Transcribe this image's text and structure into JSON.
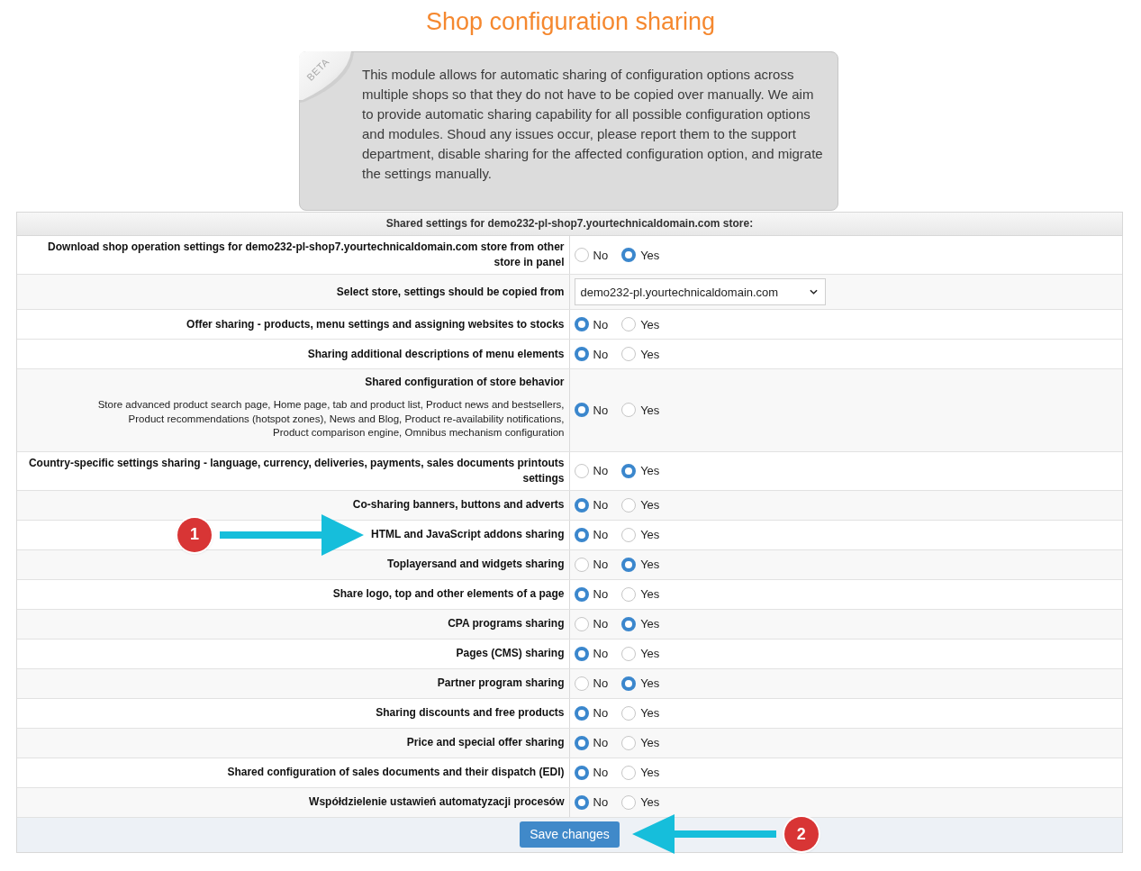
{
  "title": "Shop configuration sharing",
  "notice": {
    "ribbon": "BETA",
    "text": "This module allows for automatic sharing of configuration options across multiple shops so that they do not have to be copied over manually. We aim to provide automatic sharing capability for all possible configuration options and modules. Shoud any issues occur, please report them to the support department, disable sharing for the affected configuration option, and migrate the settings manually."
  },
  "table": {
    "header": "Shared settings for demo232-pl-shop7.yourtechnicaldomain.com store:",
    "rows": [
      {
        "kind": "radio",
        "label": "Download shop operation settings for demo232-pl-shop7.yourtechnicaldomain.com store from other store in panel",
        "options": [
          {
            "label": "No",
            "selected": false
          },
          {
            "label": "Yes",
            "selected": true
          }
        ]
      },
      {
        "kind": "select",
        "label": "Select store, settings should be copied from",
        "value": "demo232-pl.yourtechnicaldomain.com"
      },
      {
        "kind": "radio",
        "label": "Offer sharing - products, menu settings and assigning websites to stocks",
        "options": [
          {
            "label": "No",
            "selected": true
          },
          {
            "label": "Yes",
            "selected": false
          }
        ]
      },
      {
        "kind": "radio",
        "label": "Sharing additional descriptions of menu elements",
        "options": [
          {
            "label": "No",
            "selected": true
          },
          {
            "label": "Yes",
            "selected": false
          }
        ]
      },
      {
        "kind": "radio",
        "label": "Shared configuration of store behavior",
        "description": "Store advanced product search page, Home page, tab and product list, Product news and bestsellers, Product recommendations (hotspot zones), News and Blog, Product re-availability notifications, Product comparison engine, Omnibus mechanism configuration",
        "options": [
          {
            "label": "No",
            "selected": true
          },
          {
            "label": "Yes",
            "selected": false
          }
        ]
      },
      {
        "kind": "radio",
        "label": "Country-specific settings sharing - language, currency, deliveries, payments, sales documents printouts settings",
        "options": [
          {
            "label": "No",
            "selected": false
          },
          {
            "label": "Yes",
            "selected": true
          }
        ]
      },
      {
        "kind": "radio",
        "label": "Co-sharing banners, buttons and adverts",
        "options": [
          {
            "label": "No",
            "selected": true
          },
          {
            "label": "Yes",
            "selected": false
          }
        ]
      },
      {
        "kind": "radio",
        "label": "HTML and JavaScript addons sharing",
        "callout": "1",
        "options": [
          {
            "label": "No",
            "selected": true
          },
          {
            "label": "Yes",
            "selected": false
          }
        ]
      },
      {
        "kind": "radio",
        "label": "Toplayersand and widgets sharing",
        "options": [
          {
            "label": "No",
            "selected": false
          },
          {
            "label": "Yes",
            "selected": true
          }
        ]
      },
      {
        "kind": "radio",
        "label": "Share logo, top and other elements of a page",
        "options": [
          {
            "label": "No",
            "selected": true
          },
          {
            "label": "Yes",
            "selected": false
          }
        ]
      },
      {
        "kind": "radio",
        "label": "CPA programs sharing",
        "options": [
          {
            "label": "No",
            "selected": false
          },
          {
            "label": "Yes",
            "selected": true
          }
        ]
      },
      {
        "kind": "radio",
        "label": "Pages (CMS) sharing",
        "options": [
          {
            "label": "No",
            "selected": true
          },
          {
            "label": "Yes",
            "selected": false
          }
        ]
      },
      {
        "kind": "radio",
        "label": "Partner program sharing",
        "options": [
          {
            "label": "No",
            "selected": false
          },
          {
            "label": "Yes",
            "selected": true
          }
        ]
      },
      {
        "kind": "radio",
        "label": "Sharing discounts and free products",
        "options": [
          {
            "label": "No",
            "selected": true
          },
          {
            "label": "Yes",
            "selected": false
          }
        ]
      },
      {
        "kind": "radio",
        "label": "Price and special offer sharing",
        "options": [
          {
            "label": "No",
            "selected": true
          },
          {
            "label": "Yes",
            "selected": false
          }
        ]
      },
      {
        "kind": "radio",
        "label": "Shared configuration of sales documents and their dispatch (EDI)",
        "options": [
          {
            "label": "No",
            "selected": true
          },
          {
            "label": "Yes",
            "selected": false
          }
        ]
      },
      {
        "kind": "radio",
        "label": "Współdzielenie ustawień automatyzacji procesów",
        "options": [
          {
            "label": "No",
            "selected": true
          },
          {
            "label": "Yes",
            "selected": false
          }
        ]
      }
    ],
    "footer": {
      "save_button": {
        "label": "Save changes",
        "callout": "2"
      }
    }
  }
}
